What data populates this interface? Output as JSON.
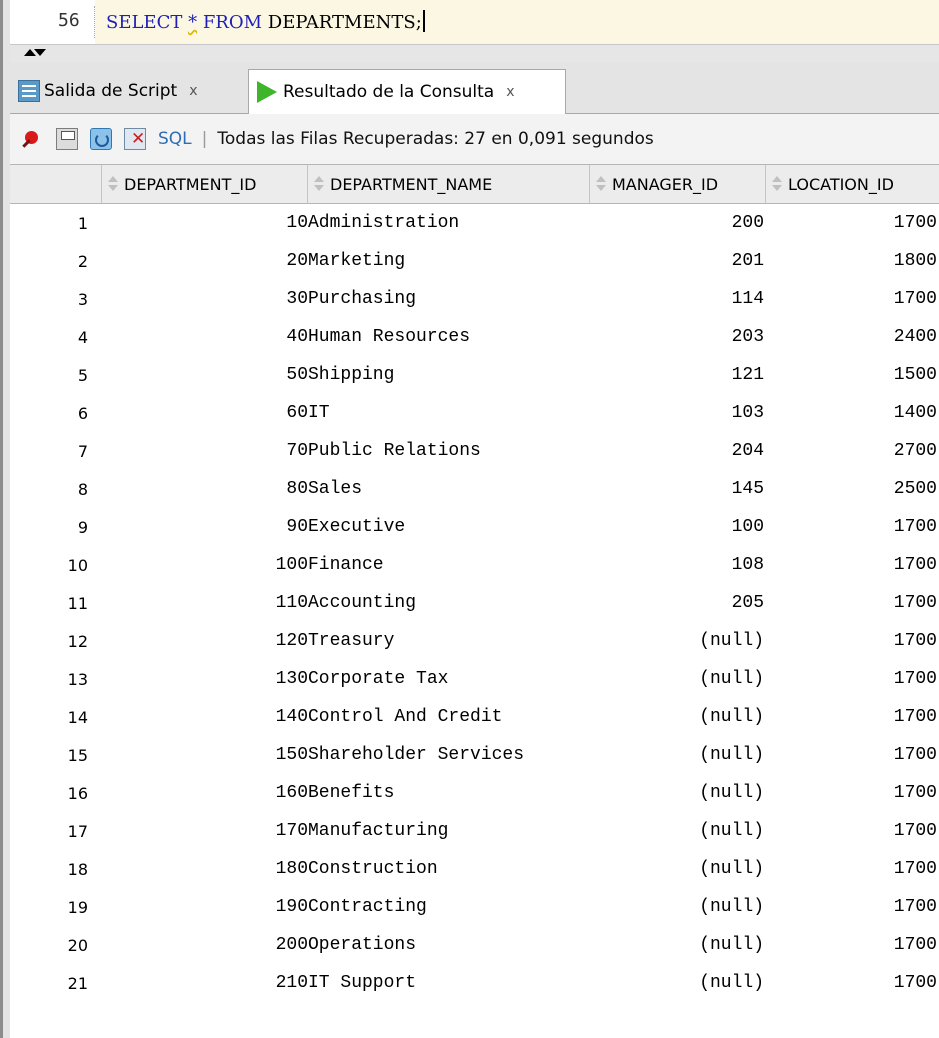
{
  "editor": {
    "line_number": "56",
    "code": {
      "kw_select": "SELECT",
      "star": "*",
      "kw_from": "FROM",
      "table": "DEPARTMENTS;"
    }
  },
  "tabs": [
    {
      "label": "Salida de Script",
      "close": "x",
      "icon": "script-output-icon"
    },
    {
      "label": "Resultado de la Consulta",
      "close": "x",
      "icon": "run-query-icon"
    }
  ],
  "toolbar": {
    "sql_label": "SQL",
    "separator": "|",
    "status": "Todas las Filas Recuperadas: 27 en 0,091 segundos"
  },
  "grid": {
    "columns": [
      "DEPARTMENT_ID",
      "DEPARTMENT_NAME",
      "MANAGER_ID",
      "LOCATION_ID"
    ],
    "rows": [
      [
        "1",
        "10",
        "Administration",
        "200",
        "1700"
      ],
      [
        "2",
        "20",
        "Marketing",
        "201",
        "1800"
      ],
      [
        "3",
        "30",
        "Purchasing",
        "114",
        "1700"
      ],
      [
        "4",
        "40",
        "Human Resources",
        "203",
        "2400"
      ],
      [
        "5",
        "50",
        "Shipping",
        "121",
        "1500"
      ],
      [
        "6",
        "60",
        "IT",
        "103",
        "1400"
      ],
      [
        "7",
        "70",
        "Public Relations",
        "204",
        "2700"
      ],
      [
        "8",
        "80",
        "Sales",
        "145",
        "2500"
      ],
      [
        "9",
        "90",
        "Executive",
        "100",
        "1700"
      ],
      [
        "10",
        "100",
        "Finance",
        "108",
        "1700"
      ],
      [
        "11",
        "110",
        "Accounting",
        "205",
        "1700"
      ],
      [
        "12",
        "120",
        "Treasury",
        "(null)",
        "1700"
      ],
      [
        "13",
        "130",
        "Corporate Tax",
        "(null)",
        "1700"
      ],
      [
        "14",
        "140",
        "Control And Credit",
        "(null)",
        "1700"
      ],
      [
        "15",
        "150",
        "Shareholder Services",
        "(null)",
        "1700"
      ],
      [
        "16",
        "160",
        "Benefits",
        "(null)",
        "1700"
      ],
      [
        "17",
        "170",
        "Manufacturing",
        "(null)",
        "1700"
      ],
      [
        "18",
        "180",
        "Construction",
        "(null)",
        "1700"
      ],
      [
        "19",
        "190",
        "Contracting",
        "(null)",
        "1700"
      ],
      [
        "20",
        "200",
        "Operations",
        "(null)",
        "1700"
      ],
      [
        "21",
        "210",
        "IT Support",
        "(null)",
        "1700"
      ]
    ]
  }
}
